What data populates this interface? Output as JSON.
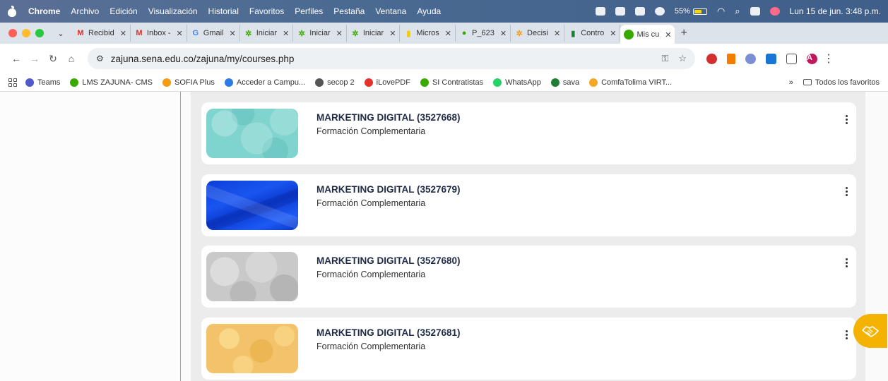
{
  "menubar": {
    "app": "Chrome",
    "items": [
      "Archivo",
      "Edición",
      "Visualización",
      "Historial",
      "Favoritos",
      "Perfiles",
      "Pestaña",
      "Ventana",
      "Ayuda"
    ],
    "battery": "55%",
    "clock": "Lun 15 de jun.  3:48 p.m."
  },
  "tabs": [
    {
      "label": "Recibid",
      "icon": "gmail-icon",
      "color": "#d93025",
      "glyph": "M"
    },
    {
      "label": "Inbox -",
      "icon": "gmail-icon",
      "color": "#d93025",
      "glyph": "M"
    },
    {
      "label": "Gmail",
      "icon": "google-icon",
      "color": "#4285f4",
      "glyph": "G"
    },
    {
      "label": "Iniciar",
      "icon": "sena-icon",
      "color": "#39a900",
      "glyph": "✲"
    },
    {
      "label": "Iniciar",
      "icon": "sena-icon",
      "color": "#39a900",
      "glyph": "✲"
    },
    {
      "label": "Iniciar",
      "icon": "sena-icon",
      "color": "#39a900",
      "glyph": "✲"
    },
    {
      "label": "Micros",
      "icon": "powerbi-icon",
      "color": "#f2c811",
      "glyph": "▮"
    },
    {
      "label": "P_623",
      "icon": "sena-circle-icon",
      "color": "#39a900",
      "glyph": "●"
    },
    {
      "label": "Decisi",
      "icon": "star-icon",
      "color": "#f39c12",
      "glyph": "✲"
    },
    {
      "label": "Contro",
      "icon": "sheet-icon",
      "color": "#1e7e34",
      "glyph": "▮"
    }
  ],
  "active_tab": {
    "label": "Mis cu",
    "icon": "sena-circle-icon",
    "color": "#39a900",
    "glyph": "●"
  },
  "address": {
    "url": "zajuna.sena.edu.co/zajuna/my/courses.php"
  },
  "bookmarks": [
    {
      "label": "Teams",
      "color": "#5059c9"
    },
    {
      "label": "LMS ZAJUNA- CMS",
      "color": "#39a900"
    },
    {
      "label": "SOFIA Plus",
      "color": "#f39c12"
    },
    {
      "label": "Acceder a Campu...",
      "color": "#2c7be5"
    },
    {
      "label": "secop 2",
      "color": "#555555"
    },
    {
      "label": "iLovePDF",
      "color": "#e5322d"
    },
    {
      "label": "SI Contratistas",
      "color": "#39a900"
    },
    {
      "label": "WhatsApp",
      "color": "#25d366"
    },
    {
      "label": "sava",
      "color": "#1e7e34"
    },
    {
      "label": "ComfaTolima VIRT...",
      "color": "#f5a623"
    }
  ],
  "bookmarks_more": "»",
  "all_bookmarks": "Todos los favoritos",
  "courses": [
    {
      "title": "MARKETING DIGITAL (3527668)",
      "category": "Formación Complementaria",
      "theme": "thumb-teal"
    },
    {
      "title": "MARKETING DIGITAL (3527679)",
      "category": "Formación Complementaria",
      "theme": "thumb-blue"
    },
    {
      "title": "MARKETING DIGITAL (3527680)",
      "category": "Formación Complementaria",
      "theme": "thumb-gray"
    },
    {
      "title": "MARKETING DIGITAL (3527681)",
      "category": "Formación Complementaria",
      "theme": "thumb-yellow"
    }
  ],
  "profile_initial": "A",
  "colors": {
    "accent_green": "#8bc34a",
    "help_fab": "#f5b301",
    "title_color": "#1e2a47"
  }
}
